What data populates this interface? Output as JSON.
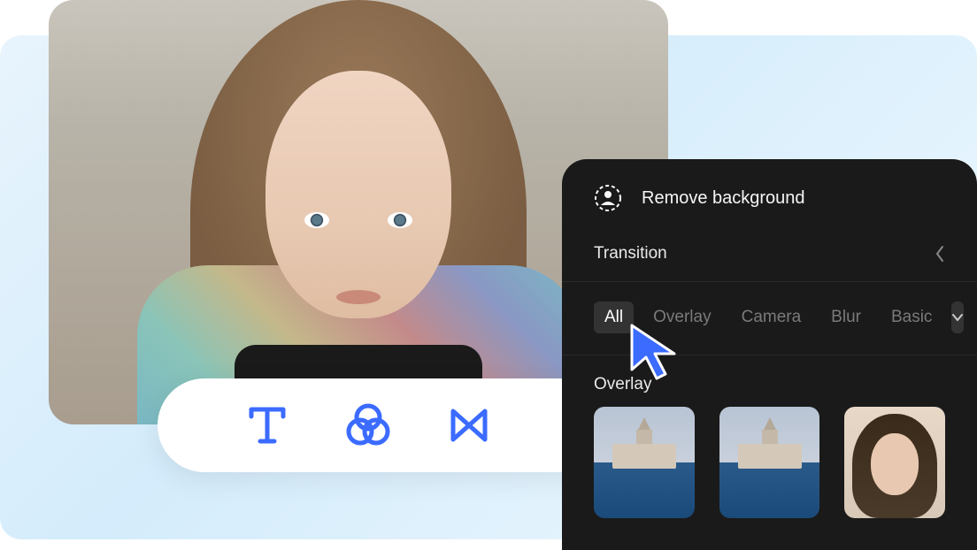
{
  "panel": {
    "title": "Remove background",
    "section_label": "Transition",
    "group_label": "Overlay"
  },
  "tabs": [
    {
      "label": "All",
      "active": true
    },
    {
      "label": "Overlay",
      "active": false
    },
    {
      "label": "Camera",
      "active": false
    },
    {
      "label": "Blur",
      "active": false
    },
    {
      "label": "Basic",
      "active": false
    }
  ],
  "toolbar": {
    "tools": [
      "text",
      "filters",
      "transition"
    ]
  },
  "thumbnails": [
    {
      "kind": "tower"
    },
    {
      "kind": "tower"
    },
    {
      "kind": "person"
    }
  ],
  "colors": {
    "accent": "#3b6bff",
    "panel_bg": "#1a1a1a"
  }
}
